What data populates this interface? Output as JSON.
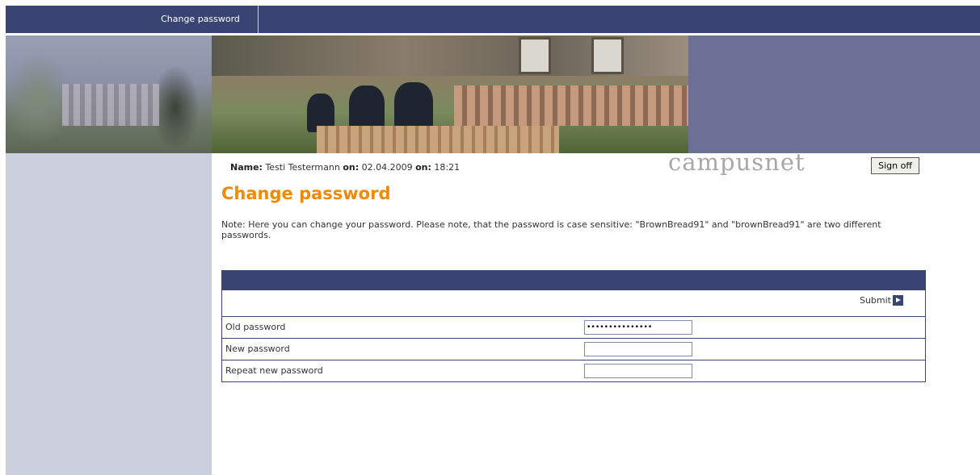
{
  "nav": {
    "tabs": [
      {
        "label": "Change password"
      }
    ]
  },
  "header": {
    "brand": "campusnet",
    "sign_off_label": "Sign off",
    "user": {
      "name_label": "Name:",
      "name_value": "Testi Testermann",
      "date_label": "on:",
      "date_value": "02.04.2009",
      "time_label": "on:",
      "time_value": "18:21"
    }
  },
  "main": {
    "title": "Change password",
    "note": "Note:  Here you can change your password. Please note, that the password is case sensitive: \"BrownBread91\" and \"brownBread91\" are two different passwords.",
    "form": {
      "submit_label": "Submit",
      "fields": [
        {
          "label": "Old password",
          "value": "•••••••••••••••"
        },
        {
          "label": "New password",
          "value": ""
        },
        {
          "label": "Repeat new password",
          "value": ""
        }
      ]
    }
  },
  "colors": {
    "nav_bg": "#3a4472",
    "title": "#f08a00",
    "sidebar": "#ccd0dc",
    "banner_right": "#6b7094"
  }
}
